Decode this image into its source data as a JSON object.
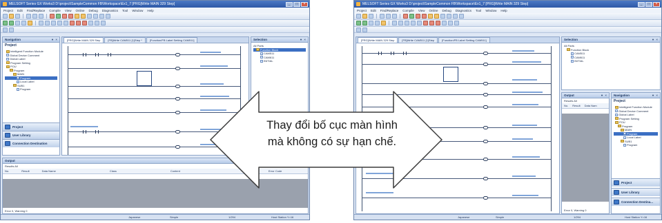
{
  "left": {
    "title": "MELSOFT Series GX Works3 D:\\project\\SampleCommon FB\\Workspace\\Ex1_7  [PRG]Write MAIN 329 Step]",
    "menu": [
      "Project",
      "Edit",
      "Find/Replace",
      "Compile",
      "View",
      "Online",
      "Debug",
      "Diagnostics",
      "Tool",
      "Window",
      "Help"
    ],
    "navigation": {
      "header": "Navigation",
      "sub_title": "Project",
      "tree": [
        "Intelligent Function Module",
        "Global Device Comment",
        "Global Label",
        "Program Setting",
        "POU",
        "Program",
        "MAIN",
        "Program",
        "Local Label",
        "SUB1",
        "Program"
      ],
      "buttons": [
        "Project",
        "User Library",
        "Connection Destination"
      ]
    },
    "tabs": [
      "[PRG]Write MAIN 329 Step",
      "[FB]Write CAM511 [1]Step *",
      "[Function/FB Label Setting CAM511]"
    ],
    "selection": {
      "header": "Selection",
      "all_parts": "All Parts",
      "items": [
        "Function Block",
        "CAM511",
        "CAM611",
        "INITIAL"
      ]
    },
    "output": {
      "header": "Output",
      "result_label": "Results All",
      "columns": [
        "No.",
        "Result",
        "Data Name",
        "Class",
        "Content",
        "Error Code"
      ]
    },
    "status": {
      "summary": "Error 0, Warning 0",
      "lang": "Japanese",
      "mode": "Simple",
      "num": "1/294",
      "station": "Host Station Y=16"
    }
  },
  "right": {
    "title": "MELSOFT Series GX Works3 D:\\project\\SampleCommon FB\\Workspace\\Ex1_7  [PRG]Write MAIN 329 Step]",
    "menu": [
      "Project",
      "Edit",
      "Find/Replace",
      "Compile",
      "View",
      "Online",
      "Debug",
      "Diagnostics",
      "Tool",
      "Window",
      "Help"
    ],
    "tabs": [
      "[PRG]Write MAIN 329 Step",
      "[FB]Write CAM511 [1]Step",
      "[Function/FB Label Setting CAM511]"
    ],
    "selection": {
      "header": "Selection",
      "all_parts": "All Parts",
      "items": [
        "Function Block",
        "CAM511",
        "CAM611",
        "INITIAL"
      ]
    },
    "output": {
      "header": "Output",
      "result_label": "Results All",
      "columns": [
        "No.",
        "Result",
        "Data Nam"
      ],
      "summary": "Error 0, Warning 0"
    },
    "navigation": {
      "header": "Navigation",
      "sub_title": "Project",
      "tree": [
        "Intelligent Function Module",
        "Global Device Comment",
        "Global Label",
        "Program Setting",
        "POU",
        "Program",
        "MAIN",
        "Program",
        "Local Label",
        "SUB1",
        "Program"
      ],
      "buttons": [
        "Project",
        "User Library",
        "Connection Destina..."
      ]
    },
    "status": {
      "lang": "Japanese",
      "mode": "Simple",
      "num": "1/294",
      "station": "Host Station Y=16"
    }
  },
  "callout": {
    "line1": "Thay đổi bố cục màn hình",
    "line2": "mà không có sự hạn chế."
  },
  "colors": {
    "titlebar": "#2d58a6",
    "pane_head": "#b7cbe8",
    "arrow_fill": "#ffffff",
    "arrow_stroke": "#3a3a3a"
  }
}
